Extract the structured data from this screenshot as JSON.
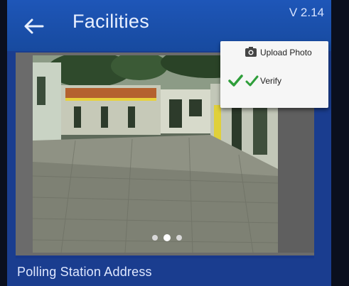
{
  "appbar": {
    "title": "Facilities",
    "version": "V 2.14",
    "back_icon": "arrow-left-icon"
  },
  "overflow_menu": {
    "items": [
      {
        "label": "Upload Photo",
        "icon": "camera-upload-icon"
      },
      {
        "label": "Verify",
        "icon": "check-icon"
      }
    ]
  },
  "carousel": {
    "page_count": 3,
    "active_page": 2
  },
  "section": {
    "label": "Polling Station Address"
  },
  "colors": {
    "appbar": "#1e56b8",
    "background": "#1a3d8f",
    "check": "#2e9e3a"
  }
}
